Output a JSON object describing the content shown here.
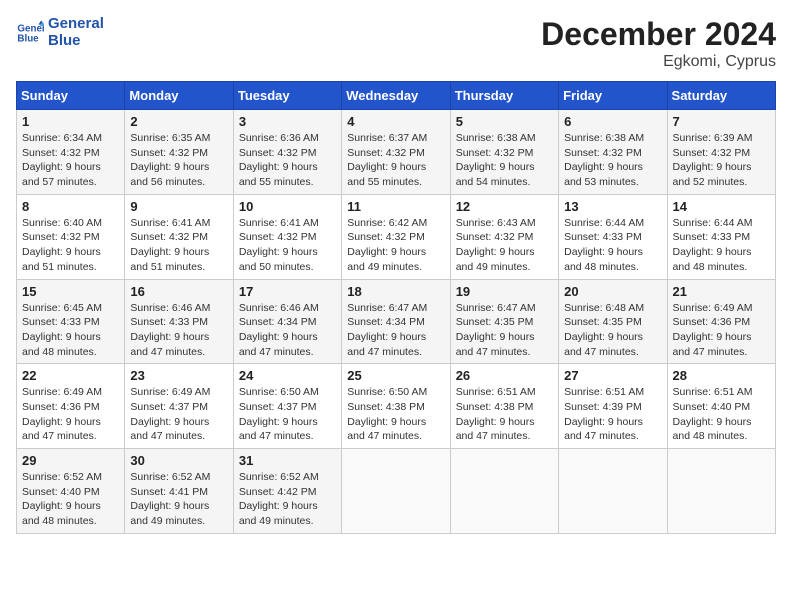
{
  "header": {
    "logo_line1": "General",
    "logo_line2": "Blue",
    "month": "December 2024",
    "location": "Egkomi, Cyprus"
  },
  "days_of_week": [
    "Sunday",
    "Monday",
    "Tuesday",
    "Wednesday",
    "Thursday",
    "Friday",
    "Saturday"
  ],
  "weeks": [
    [
      {
        "day": "1",
        "sunrise": "6:34 AM",
        "sunset": "4:32 PM",
        "daylight": "9 hours and 57 minutes."
      },
      {
        "day": "2",
        "sunrise": "6:35 AM",
        "sunset": "4:32 PM",
        "daylight": "9 hours and 56 minutes."
      },
      {
        "day": "3",
        "sunrise": "6:36 AM",
        "sunset": "4:32 PM",
        "daylight": "9 hours and 55 minutes."
      },
      {
        "day": "4",
        "sunrise": "6:37 AM",
        "sunset": "4:32 PM",
        "daylight": "9 hours and 55 minutes."
      },
      {
        "day": "5",
        "sunrise": "6:38 AM",
        "sunset": "4:32 PM",
        "daylight": "9 hours and 54 minutes."
      },
      {
        "day": "6",
        "sunrise": "6:38 AM",
        "sunset": "4:32 PM",
        "daylight": "9 hours and 53 minutes."
      },
      {
        "day": "7",
        "sunrise": "6:39 AM",
        "sunset": "4:32 PM",
        "daylight": "9 hours and 52 minutes."
      }
    ],
    [
      {
        "day": "8",
        "sunrise": "6:40 AM",
        "sunset": "4:32 PM",
        "daylight": "9 hours and 51 minutes."
      },
      {
        "day": "9",
        "sunrise": "6:41 AM",
        "sunset": "4:32 PM",
        "daylight": "9 hours and 51 minutes."
      },
      {
        "day": "10",
        "sunrise": "6:41 AM",
        "sunset": "4:32 PM",
        "daylight": "9 hours and 50 minutes."
      },
      {
        "day": "11",
        "sunrise": "6:42 AM",
        "sunset": "4:32 PM",
        "daylight": "9 hours and 49 minutes."
      },
      {
        "day": "12",
        "sunrise": "6:43 AM",
        "sunset": "4:32 PM",
        "daylight": "9 hours and 49 minutes."
      },
      {
        "day": "13",
        "sunrise": "6:44 AM",
        "sunset": "4:33 PM",
        "daylight": "9 hours and 48 minutes."
      },
      {
        "day": "14",
        "sunrise": "6:44 AM",
        "sunset": "4:33 PM",
        "daylight": "9 hours and 48 minutes."
      }
    ],
    [
      {
        "day": "15",
        "sunrise": "6:45 AM",
        "sunset": "4:33 PM",
        "daylight": "9 hours and 48 minutes."
      },
      {
        "day": "16",
        "sunrise": "6:46 AM",
        "sunset": "4:33 PM",
        "daylight": "9 hours and 47 minutes."
      },
      {
        "day": "17",
        "sunrise": "6:46 AM",
        "sunset": "4:34 PM",
        "daylight": "9 hours and 47 minutes."
      },
      {
        "day": "18",
        "sunrise": "6:47 AM",
        "sunset": "4:34 PM",
        "daylight": "9 hours and 47 minutes."
      },
      {
        "day": "19",
        "sunrise": "6:47 AM",
        "sunset": "4:35 PM",
        "daylight": "9 hours and 47 minutes."
      },
      {
        "day": "20",
        "sunrise": "6:48 AM",
        "sunset": "4:35 PM",
        "daylight": "9 hours and 47 minutes."
      },
      {
        "day": "21",
        "sunrise": "6:49 AM",
        "sunset": "4:36 PM",
        "daylight": "9 hours and 47 minutes."
      }
    ],
    [
      {
        "day": "22",
        "sunrise": "6:49 AM",
        "sunset": "4:36 PM",
        "daylight": "9 hours and 47 minutes."
      },
      {
        "day": "23",
        "sunrise": "6:49 AM",
        "sunset": "4:37 PM",
        "daylight": "9 hours and 47 minutes."
      },
      {
        "day": "24",
        "sunrise": "6:50 AM",
        "sunset": "4:37 PM",
        "daylight": "9 hours and 47 minutes."
      },
      {
        "day": "25",
        "sunrise": "6:50 AM",
        "sunset": "4:38 PM",
        "daylight": "9 hours and 47 minutes."
      },
      {
        "day": "26",
        "sunrise": "6:51 AM",
        "sunset": "4:38 PM",
        "daylight": "9 hours and 47 minutes."
      },
      {
        "day": "27",
        "sunrise": "6:51 AM",
        "sunset": "4:39 PM",
        "daylight": "9 hours and 47 minutes."
      },
      {
        "day": "28",
        "sunrise": "6:51 AM",
        "sunset": "4:40 PM",
        "daylight": "9 hours and 48 minutes."
      }
    ],
    [
      {
        "day": "29",
        "sunrise": "6:52 AM",
        "sunset": "4:40 PM",
        "daylight": "9 hours and 48 minutes."
      },
      {
        "day": "30",
        "sunrise": "6:52 AM",
        "sunset": "4:41 PM",
        "daylight": "9 hours and 49 minutes."
      },
      {
        "day": "31",
        "sunrise": "6:52 AM",
        "sunset": "4:42 PM",
        "daylight": "9 hours and 49 minutes."
      },
      null,
      null,
      null,
      null
    ]
  ],
  "labels": {
    "sunrise": "Sunrise: ",
    "sunset": "Sunset: ",
    "daylight": "Daylight: "
  }
}
